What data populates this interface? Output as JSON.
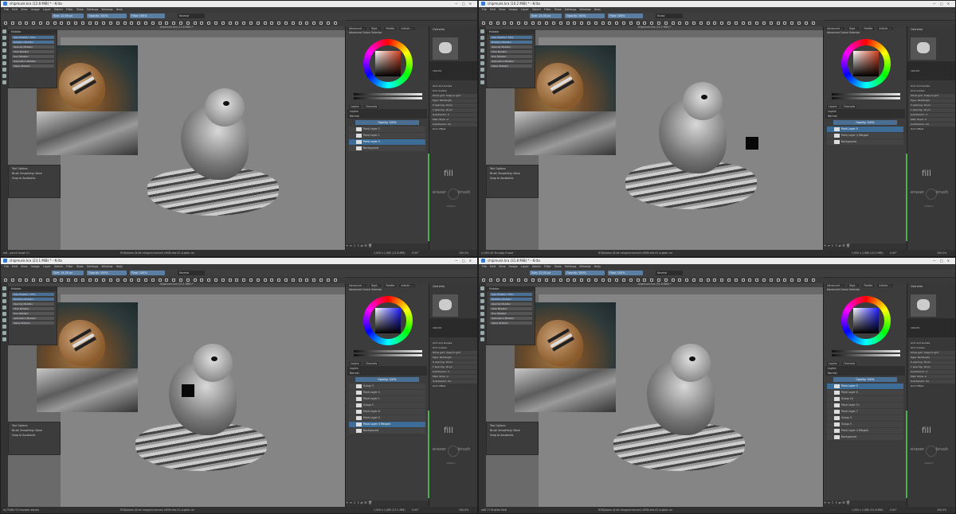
{
  "windows": [
    {
      "title": "chipmunk.kra (12.8 MiB) * - Krita",
      "tool_options": {
        "size": "Size: 10.00 px",
        "opacity": "Opacity: 100%",
        "flow": "Flow: 100%",
        "blend_mode": "Normal"
      },
      "canvas_title": "chipmunk.kra (12.8 MiB) *",
      "layers": [
        {
          "name": "Paint Layer 2",
          "selected": false
        },
        {
          "name": "Paint Layer 1",
          "selected": false
        },
        {
          "name": "Paint Layer 3",
          "selected": true
        },
        {
          "name": "Background",
          "selected": false
        }
      ],
      "status": {
        "left": "m8 - pencil rough 01",
        "middle": "RGB/Alpha (8-bit integer/channel) sRGB-elle-V2-srgbtrc.icc",
        "dims": "1,920 x 1,080 (12.8 MiB)",
        "rotation": "0.00°",
        "zoom": "100.0%"
      }
    },
    {
      "title": "chipmunk.kra (10.2 MiB) * - Krita",
      "tool_options": {
        "size": "Size: 24.00 px",
        "opacity": "Opacity: 100%",
        "flow": "Flow: 100%",
        "blend_mode": "Erase"
      },
      "canvas_title": "chipmunk.kra (10.2 MiB) *",
      "layers": [
        {
          "name": "Paint Layer 5",
          "selected": true
        },
        {
          "name": "Paint Layer 4 Merged",
          "selected": false
        },
        {
          "name": "Background",
          "selected": false
        }
      ],
      "status": {
        "left": "c) 063-40 Smudgy Eraser",
        "middle": "RGB/Alpha (8-bit integer/channel) sRGB-elle-V2-srgbtrc.icc",
        "dims": "1,920 x 1,080 (10.2 MiB)",
        "rotation": "0.00°",
        "zoom": "100.0%"
      }
    },
    {
      "title": "chipmunk.kra (23.1 MiB) * - Krita",
      "tool_options": {
        "size": "Size: 14.00 px",
        "opacity": "Opacity: 100%",
        "flow": "Flow: 100%",
        "blend_mode": "Normal"
      },
      "canvas_title": "chipmunk.kra (23.1 MiB) *",
      "layers": [
        {
          "name": "Group 3",
          "selected": false
        },
        {
          "name": "Paint Layer 4",
          "selected": false
        },
        {
          "name": "Paint Layer 1",
          "selected": false
        },
        {
          "name": "Group 5",
          "selected": false
        },
        {
          "name": "Paint Layer 6",
          "selected": false
        },
        {
          "name": "Paint Layer 5",
          "selected": false
        },
        {
          "name": "Paint Layer 4 Merged",
          "selected": true
        },
        {
          "name": "Background",
          "selected": false
        }
      ],
      "status": {
        "left": "m) RGBA 05 Impasto details",
        "middle": "RGB/Alpha (8-bit integer/channel) sRGB-elle-V2-srgbtrc.icc",
        "dims": "1,920 x 1,080 (23.1 MiB)",
        "rotation": "0.00°",
        "zoom": "100.0%"
      }
    },
    {
      "title": "chipmunk.kra (31.8 MiB) * - Krita",
      "tool_options": {
        "size": "Size: 22.00 px",
        "opacity": "Opacity: 100%",
        "flow": "Flow: 100%",
        "blend_mode": "Normal"
      },
      "canvas_title": "chipmunk.kra (31.8 MiB) *",
      "layers": [
        {
          "name": "Paint Layer 5",
          "selected": true
        },
        {
          "name": "Paint Layer 6",
          "selected": false
        },
        {
          "name": "Group 10",
          "selected": false
        },
        {
          "name": "Paint Layer 11",
          "selected": false
        },
        {
          "name": "Paint Layer 7",
          "selected": false
        },
        {
          "name": "Group 3",
          "selected": false
        },
        {
          "name": "Group 5",
          "selected": false
        },
        {
          "name": "Paint Layer 4 Merged",
          "selected": false
        },
        {
          "name": "Background",
          "selected": false
        }
      ],
      "status": {
        "left": "m8f 17 Bristles Mx8",
        "middle": "RGB/Alpha (8-bit integer/channel) sRGB-elle-V2-srgbtrc.icc",
        "dims": "1,920 x 1,080 (31.8 MiB)",
        "rotation": "0.00°",
        "zoom": "100.0%"
      }
    }
  ],
  "menu": [
    "File",
    "Edit",
    "View",
    "Image",
    "Layer",
    "Select",
    "Filter",
    "Tools",
    "Settings",
    "Window",
    "Help"
  ],
  "mutator_panel": {
    "title": "Mutator",
    "rows": [
      "Size Mutator",
      "Rotation Mutator",
      "Opacity Mutator",
      "Flow Mutator",
      "Hue Mutator",
      "Saturation Mutator",
      "Value Mutator"
    ],
    "size_value": "Size Mutator: 50%"
  },
  "tool_options_panel": {
    "title": "Tool Options",
    "smoothing_label": "Brush Smoothing:",
    "smoothing_value": "None",
    "snap": "Snap to Assistants"
  },
  "right_tabs": [
    "Advanced ...",
    "Digit...",
    "Palette",
    "Artistic ..."
  ],
  "colour_selector_title": "Advanced Colour Selector",
  "layers_tabs": [
    "Layers",
    "Channels"
  ],
  "layers_title": "Layers",
  "layers_mode": "Normal",
  "layers_opacity": "Opacity: 100%",
  "overview_title": "Overview",
  "grid_panel": {
    "title": "Grid and Guides",
    "tabs": [
      "Grid",
      "Guides"
    ],
    "show_grid": "Show grid",
    "snap_grid": "Snap to grid",
    "type": "Type: Rectangle",
    "x_spacing": "X spacing: 16 px",
    "y_spacing": "Y spacing: 16 px",
    "subdivision": "Subdivision: 2",
    "main_style": "Main Style: Li",
    "subdiv_style": "Subdivision: Do",
    "offset": "Grid Offset"
  },
  "popup_palette": {
    "fill": "fill",
    "eraser": "eraser",
    "brush": "brush",
    "rotation": "rotation"
  },
  "zoom_right": "100.0%",
  "accent_colors": {
    "selection": "#3d6c97",
    "field": "#5a7fa3",
    "divider": "#4caf50"
  }
}
